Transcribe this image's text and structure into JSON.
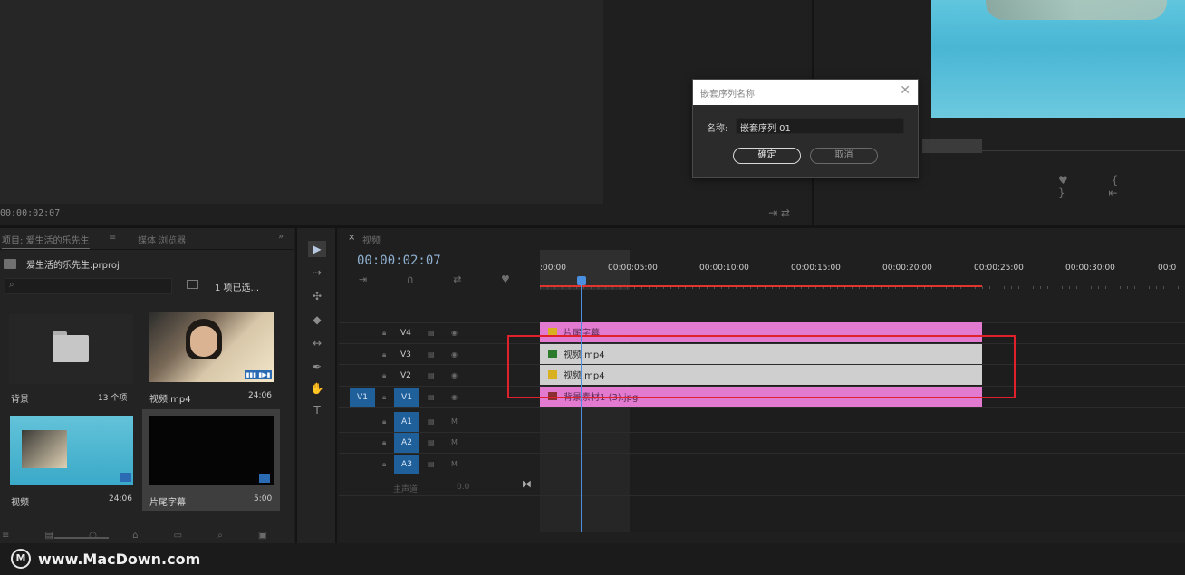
{
  "source_monitor": {
    "timecode": "00:00:02:07",
    "controls_icons": "⇥ ⇄"
  },
  "program_monitor": {
    "buttons": "♥ { } ⇤"
  },
  "dialog": {
    "title": "嵌套序列名称",
    "close": "✕",
    "name_label": "名称:",
    "name_value": "嵌套序列 01",
    "ok_label": "确定",
    "cancel_label": "取消"
  },
  "project": {
    "tab_label": "项目: 爱生活的乐先生",
    "tab_menu": "≡",
    "media_tab": "媒体 浏览器",
    "expand": "»",
    "filename": "爱生活的乐先生.prproj",
    "search_icon": "⌕",
    "selection": "1 项已选...",
    "items": [
      {
        "name": "背景",
        "meta": "13 个项"
      },
      {
        "name": "视频.mp4",
        "meta": "24:06",
        "badge": "▮▮▮ ▮▶▮"
      },
      {
        "name": "视频",
        "meta": "24:06"
      },
      {
        "name": "片尾字幕",
        "meta": "5:00"
      }
    ],
    "bottom_icons": "≡ ▤ ○ ⌂ ▭ ⌕ ▣ ✎ ▥"
  },
  "tools": [
    {
      "name": "selection-tool",
      "glyph": "▶"
    },
    {
      "name": "track-select-tool",
      "glyph": "⇢"
    },
    {
      "name": "ripple-edit-tool",
      "glyph": "✣"
    },
    {
      "name": "razor-tool",
      "glyph": "◆"
    },
    {
      "name": "slip-tool",
      "glyph": "↔"
    },
    {
      "name": "pen-tool",
      "glyph": "✒"
    },
    {
      "name": "hand-tool",
      "glyph": "✋"
    },
    {
      "name": "type-tool",
      "glyph": "T"
    }
  ],
  "timeline": {
    "tab_close": "×",
    "tab_name": "视频",
    "timecode": "00:00:02:07",
    "tool_icons": "⇥ ∩ ⇄ ♥ ✎",
    "ruler_labels": [
      ":00:00",
      "00:00:05:00",
      "00:00:10:00",
      "00:00:15:00",
      "00:00:20:00",
      "00:00:25:00",
      "00:00:30:00",
      "00:0"
    ],
    "video_tracks": [
      "V4",
      "V3",
      "V2",
      "V1"
    ],
    "audio_tracks": [
      "A1",
      "A2",
      "A3"
    ],
    "source_target": "V1",
    "clips": [
      {
        "track": "V4",
        "name": "片尾字幕"
      },
      {
        "track": "V3",
        "name": "视频.mp4"
      },
      {
        "track": "V2",
        "name": "视频.mp4"
      },
      {
        "track": "V1",
        "name": "背景素材1 (3).jpg"
      }
    ],
    "master_label": "主声道",
    "master_value": "0.0",
    "end_marker": "⧓"
  },
  "watermark": {
    "logo": "M",
    "text": "www.MacDown.com"
  },
  "colors": {
    "accent": "#1f5f9a",
    "clip_pink": "#e27bd0",
    "clip_gray": "#cfcfcf",
    "selection_red": "#e0202a",
    "playhead": "#4a8fe0"
  }
}
